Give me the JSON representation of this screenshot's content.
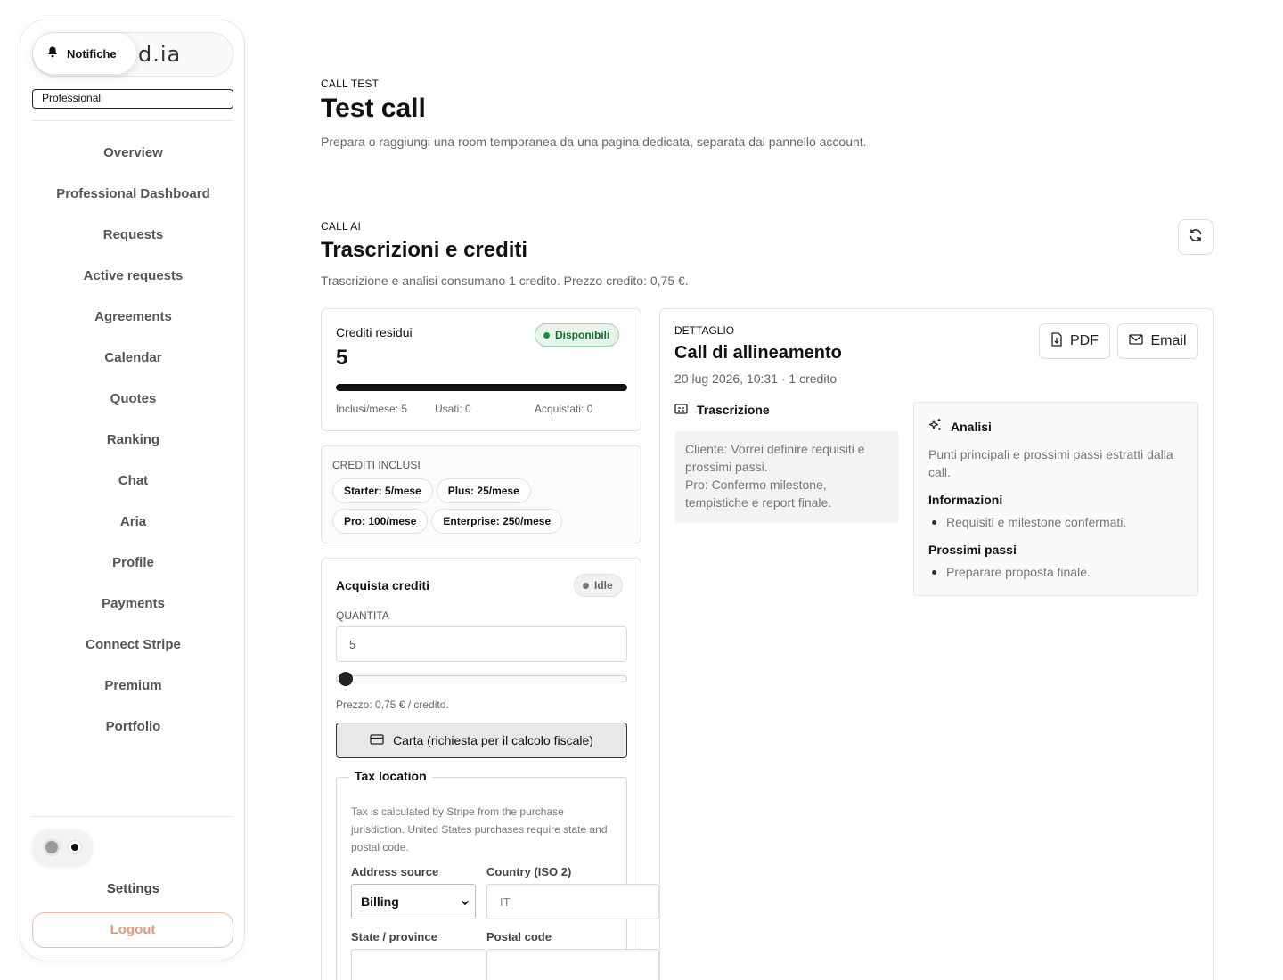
{
  "sidebar": {
    "logo_text": "d.ia",
    "notifications_label": "Notifiche",
    "role": "Professional",
    "items": [
      {
        "label": "Overview"
      },
      {
        "label": "Professional Dashboard"
      },
      {
        "label": "Requests"
      },
      {
        "label": "Active requests"
      },
      {
        "label": "Agreements"
      },
      {
        "label": "Calendar"
      },
      {
        "label": "Quotes"
      },
      {
        "label": "Ranking"
      },
      {
        "label": "Chat"
      },
      {
        "label": "Aria"
      },
      {
        "label": "Profile"
      },
      {
        "label": "Payments"
      },
      {
        "label": "Connect Stripe"
      },
      {
        "label": "Premium"
      },
      {
        "label": "Portfolio"
      }
    ],
    "settings_label": "Settings",
    "logout_label": "Logout"
  },
  "header": {
    "eyebrow": "CALL TEST",
    "title": "Test call",
    "subtitle": "Prepara o raggiungi una room temporanea da una pagina dedicata, separata dal pannello account."
  },
  "section": {
    "eyebrow": "CALL AI",
    "title": "Trascrizioni e crediti",
    "subtitle": "Trascrizione e analisi consumano 1 credito. Prezzo credito: 0,75 €."
  },
  "credits": {
    "title": "Crediti residui",
    "value": "5",
    "status": "Disponibili",
    "status_color": "#1f8a3b",
    "progress": 1.0,
    "included": "Inclusi/mese: 5",
    "used": "Usati: 0",
    "purchased": "Acquistati: 0"
  },
  "plans": {
    "title": "CREDITI INCLUSI",
    "chips": [
      {
        "label": "Starter: 5/mese"
      },
      {
        "label": "Plus: 25/mese"
      },
      {
        "label": "Pro: 100/mese"
      },
      {
        "label": "Enterprise: 250/mese"
      }
    ]
  },
  "purchase": {
    "title": "Acquista crediti",
    "status": "Idle",
    "quantity_label": "QUANTITA",
    "quantity_value": "5",
    "slider_level": 0.0,
    "price_note": "Prezzo: 0,75 € / credito.",
    "card_button": "Carta (richiesta per il calcolo fiscale)",
    "tax": {
      "legend": "Tax location",
      "note": "Tax is calculated by Stripe from the purchase jurisdiction. United States purchases require state and postal code.",
      "address_source_label": "Address source",
      "address_source_value": "Billing",
      "country_label": "Country (ISO 2)",
      "country_placeholder": "IT",
      "state_label": "State / province",
      "postal_label": "Postal code"
    }
  },
  "detail": {
    "eyebrow": "DETTAGLIO",
    "title": "Call di allineamento",
    "meta": "20 lug 2026, 10:31 · 1 credito",
    "pdf_label": "PDF",
    "email_label": "Email",
    "transcript_label": "Trascrizione",
    "transcript_lines": [
      "Cliente: Vorrei definire requisiti e prossimi passi.",
      "Pro: Confermo milestone, tempistiche e report finale."
    ],
    "analysis": {
      "title": "Analisi",
      "summary": "Punti principali e prossimi passi estratti dalla call.",
      "info_title": "Informazioni",
      "info_items": [
        "Requisiti e milestone confermati."
      ],
      "next_title": "Prossimi passi",
      "next_items": [
        "Preparare proposta finale."
      ]
    }
  }
}
